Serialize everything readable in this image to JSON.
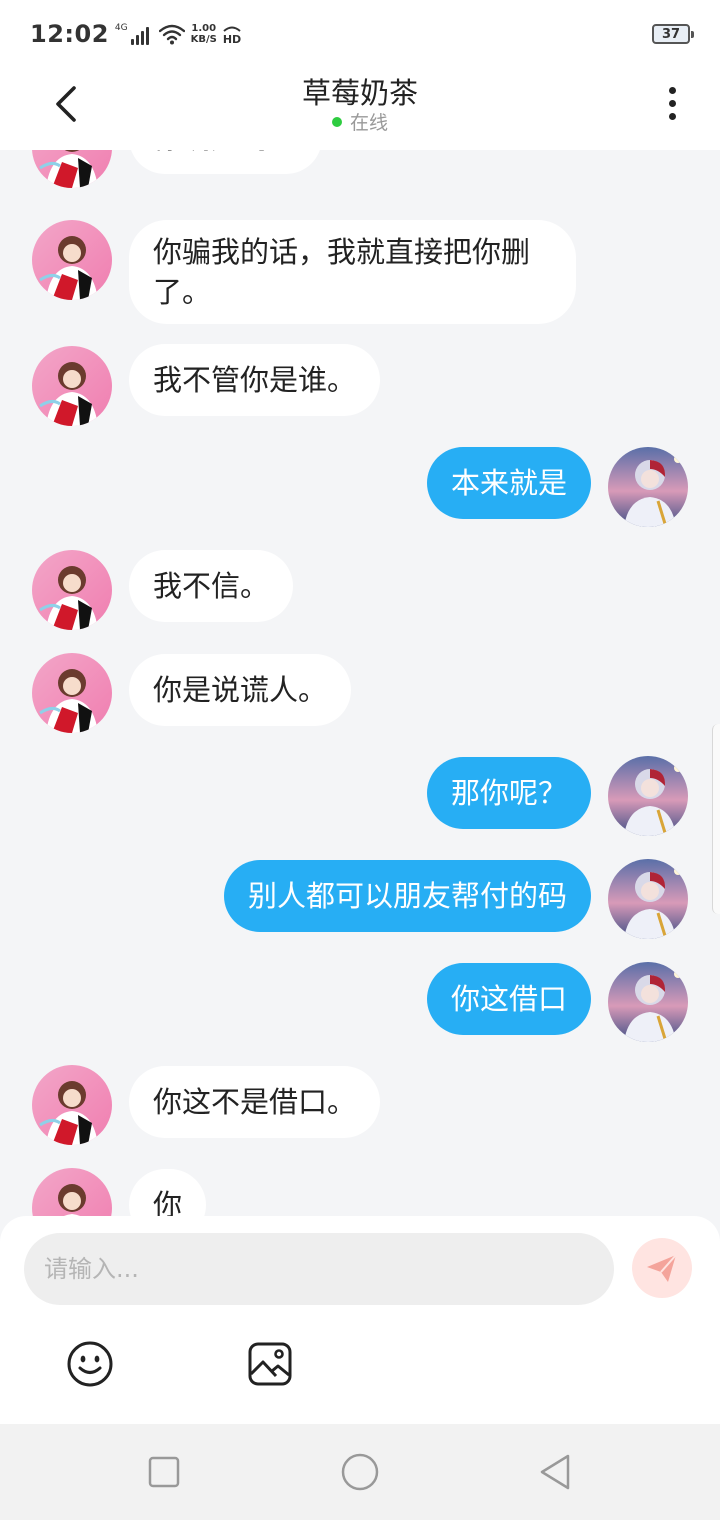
{
  "status_bar": {
    "time": "12:02",
    "network": "4G",
    "speed_value": "1.00",
    "speed_unit": "KB/S",
    "hd": "HD",
    "battery": "37"
  },
  "header": {
    "title": "草莓奶茶",
    "status": "在线",
    "status_color": "#2ecc40"
  },
  "messages": [
    {
      "side": "left",
      "text": "你确定吗？"
    },
    {
      "side": "left",
      "text": "你骗我的话，我就直接把你删了。"
    },
    {
      "side": "left",
      "text": "我不管你是谁。"
    },
    {
      "side": "right",
      "text": "本来就是"
    },
    {
      "side": "left",
      "text": "我不信。"
    },
    {
      "side": "left",
      "text": "你是说谎人。"
    },
    {
      "side": "right",
      "text": "那你呢？"
    },
    {
      "side": "right",
      "text": "别人都可以朋友帮付的码"
    },
    {
      "side": "right",
      "text": "你这借口"
    },
    {
      "side": "left",
      "text": "你这不是借口。"
    },
    {
      "side": "left",
      "text": "你"
    }
  ],
  "input": {
    "placeholder": "请输入..."
  },
  "colors": {
    "outgoing_bubble": "#27aef4",
    "incoming_bubble": "#ffffff",
    "send_button": "#ffe4e1",
    "send_icon": "#f4a49b"
  },
  "icons": {
    "back": "chevron-left-icon",
    "more": "more-vertical-icon",
    "send": "paper-plane-icon",
    "emoji": "smiley-icon",
    "image": "image-icon",
    "nav_recent": "square-icon",
    "nav_home": "circle-icon",
    "nav_back": "triangle-left-icon"
  }
}
